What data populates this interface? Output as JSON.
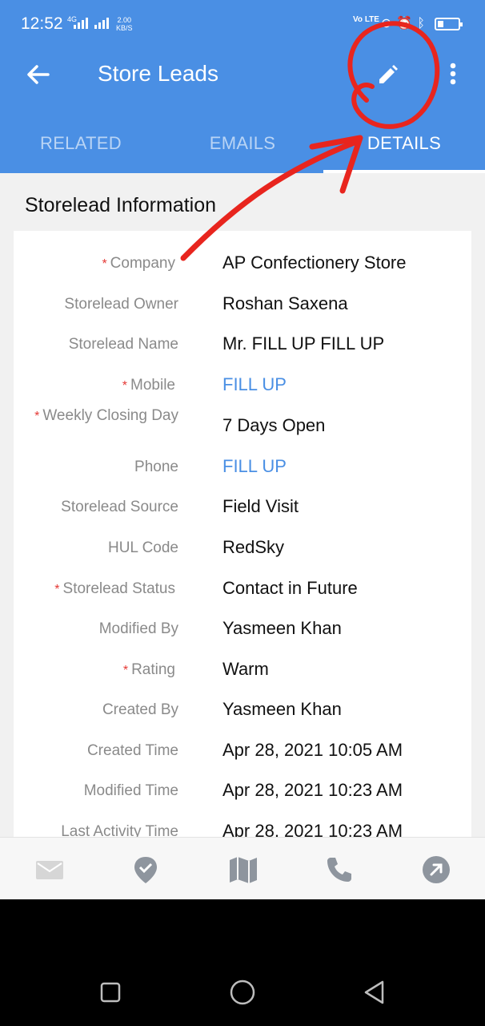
{
  "status_bar": {
    "time": "12:52",
    "network": "4G",
    "speed_value": "2.00",
    "speed_unit": "KB/S",
    "volte": "Vo LTE"
  },
  "app_bar": {
    "title": "Store Leads"
  },
  "tabs": [
    {
      "label": "RELATED",
      "active": false
    },
    {
      "label": "EMAILS",
      "active": false
    },
    {
      "label": "DETAILS",
      "active": true
    }
  ],
  "section": {
    "title": "Storelead Information"
  },
  "fields": [
    {
      "label": "Company",
      "required": true,
      "value": "AP Confectionery Store",
      "link": false
    },
    {
      "label": "Storelead Owner",
      "required": false,
      "value": "Roshan Saxena",
      "link": false
    },
    {
      "label": "Storelead Name",
      "required": false,
      "value": "Mr. FILL UP FILL UP",
      "link": false
    },
    {
      "label": "Mobile",
      "required": true,
      "value": "FILL UP",
      "link": true
    },
    {
      "label": "Weekly Closing Day",
      "required": true,
      "value": "7 Days Open",
      "link": false
    },
    {
      "label": "Phone",
      "required": false,
      "value": "FILL UP",
      "link": true
    },
    {
      "label": "Storelead Source",
      "required": false,
      "value": "Field Visit",
      "link": false
    },
    {
      "label": "HUL Code",
      "required": false,
      "value": "RedSky",
      "link": false
    },
    {
      "label": "Storelead Status",
      "required": true,
      "value": "Contact in Future",
      "link": false
    },
    {
      "label": "Modified By",
      "required": false,
      "value": "Yasmeen Khan",
      "link": false
    },
    {
      "label": "Rating",
      "required": true,
      "value": "Warm",
      "link": false
    },
    {
      "label": "Created By",
      "required": false,
      "value": "Yasmeen Khan",
      "link": false
    },
    {
      "label": "Created Time",
      "required": false,
      "value": "Apr 28, 2021 10:05 AM",
      "link": false
    },
    {
      "label": "Modified Time",
      "required": false,
      "value": "Apr 28, 2021 10:23 AM",
      "link": false
    },
    {
      "label": "Last Activity Time",
      "required": false,
      "value": "Apr 28, 2021 10:23 AM",
      "link": false
    }
  ],
  "bottom_actions": [
    "mail-icon",
    "check-in-icon",
    "map-icon",
    "phone-icon",
    "share-arrow-icon"
  ],
  "colors": {
    "primary": "#4a8fe4",
    "required": "#e53935",
    "annotation": "#e8251e"
  }
}
